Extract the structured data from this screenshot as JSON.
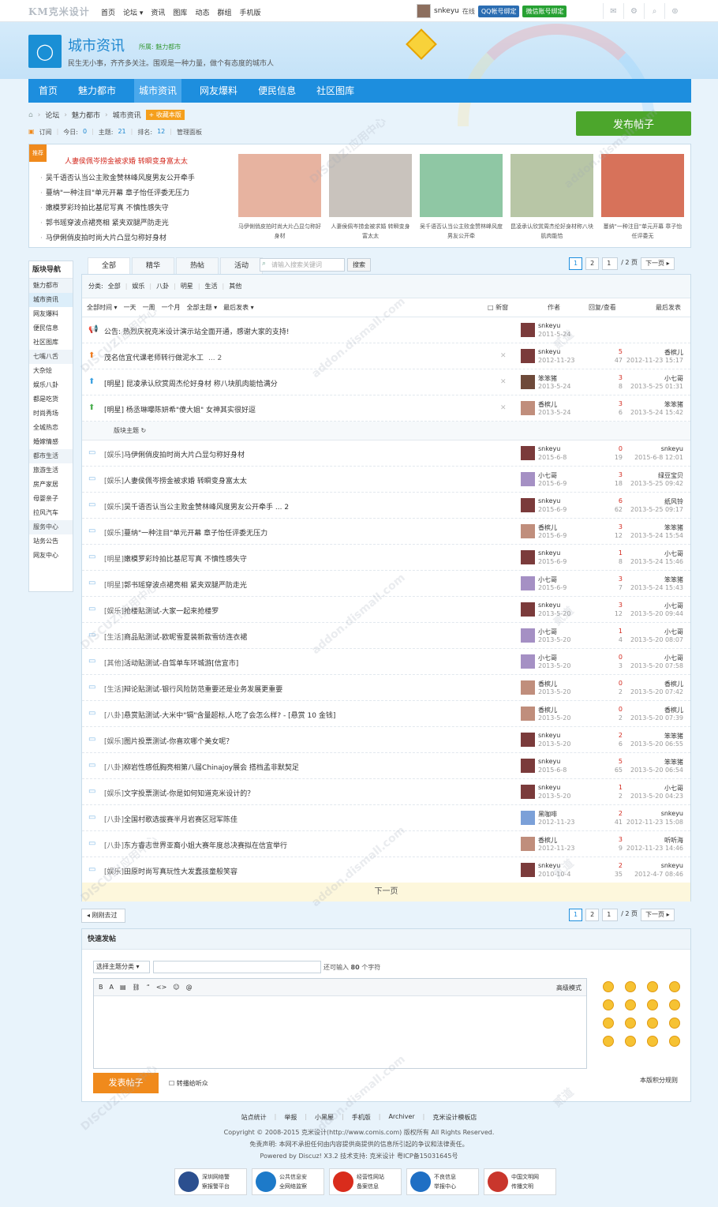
{
  "topbar": {
    "logo": "KM克米设计",
    "nav": [
      "首页",
      "论坛 ▾",
      "资讯",
      "图库",
      "动态",
      "群组",
      "手机版"
    ],
    "username": "snkeyu",
    "status": "在线",
    "qq_bind": "QQ帐号绑定",
    "wx_bind": "微信账号绑定",
    "icons": [
      "mail-icon",
      "gear-icon",
      "search-icon",
      "rss-icon"
    ]
  },
  "forum": {
    "title": "城市资讯",
    "owner": "所属: 魅力都市",
    "description": "民生无小事，齐齐多关注。围观是一种力量，做个有态度的城市人"
  },
  "mainnav": [
    "首页",
    "魅力都市",
    "城市资讯",
    "网友爆料",
    "便民信息",
    "社区图库"
  ],
  "mainnav_active": 2,
  "breadcrumb": [
    "论坛",
    "魅力都市",
    "城市资讯"
  ],
  "fav_label": "+ 收藏本版",
  "stats": {
    "subscribe": "订阅",
    "today_label": "今日:",
    "today": "0",
    "topics_label": "主题:",
    "topics": "21",
    "rank_label": "排名:",
    "rank": "12",
    "manage": "管理面板"
  },
  "new_thread_label": "发布帖子",
  "slide": {
    "tag": "推荐",
    "headline": "人妻侯佩岑捞金被求婚 转瞬变身富太太",
    "list": [
      "吴千语否认当公主败金赞林峰风度男友公开牵手",
      "蔓纳\"一种注目\"单元开幕 章子怡任评委无压力",
      "嫩模罗彩玲拍比基尼写真 不慎性感失守",
      "郭书瑶穿波点裙亮相 紧夹双腿严防走光",
      "马伊俐俏皮拍时尚大片凸显匀称好身材"
    ],
    "images": [
      {
        "caption": "马伊俐俏皮拍时尚大片凸显匀称好身材",
        "color": "#e7b3a0"
      },
      {
        "caption": "人妻侯佩岑捞金被求婚 转瞬变身富太太",
        "color": "#c9c3bd"
      },
      {
        "caption": "吴千语否认当公主败金赞林峰风度男友公开牵",
        "color": "#8fc7a4"
      },
      {
        "caption": "昆凌承认欣赏周杰伦好身材称八块肌肉能恰",
        "color": "#b8c6a6"
      },
      {
        "caption": "蔓纳\"一种注目\"单元开幕 章子怡任评委无",
        "color": "#d7725a"
      }
    ]
  },
  "sidebar": {
    "header": "版块导航",
    "items": [
      {
        "label": "魅力都市",
        "type": "grp"
      },
      {
        "label": "城市资讯",
        "type": "it",
        "active": true
      },
      {
        "label": "网友爆料",
        "type": "it"
      },
      {
        "label": "便民信息",
        "type": "it"
      },
      {
        "label": "社区图库",
        "type": "it"
      },
      {
        "label": "七嘴八舌",
        "type": "grp"
      },
      {
        "label": "大杂烩",
        "type": "it"
      },
      {
        "label": "娱乐八卦",
        "type": "it"
      },
      {
        "label": "都是吃货",
        "type": "it"
      },
      {
        "label": "时尚秀场",
        "type": "it"
      },
      {
        "label": "全城热恋",
        "type": "it"
      },
      {
        "label": "婚嫁情感",
        "type": "it"
      },
      {
        "label": "都市生活",
        "type": "grp"
      },
      {
        "label": "旅游生活",
        "type": "it"
      },
      {
        "label": "房产家居",
        "type": "it"
      },
      {
        "label": "母婴亲子",
        "type": "it"
      },
      {
        "label": "拉风汽车",
        "type": "it"
      },
      {
        "label": "服务中心",
        "type": "grp"
      },
      {
        "label": "站务公告",
        "type": "it"
      },
      {
        "label": "网友中心",
        "type": "it"
      }
    ]
  },
  "tabs": [
    "全部",
    "精华",
    "热帖",
    "活动"
  ],
  "search": {
    "placeholder": "请输入搜索关键词",
    "button": "搜索"
  },
  "pager": {
    "p1": "1",
    "p2": "2",
    "input": "1",
    "total": "/ 2 页",
    "next": "下一页 ▸"
  },
  "typebar": [
    "分类:",
    "全部",
    "|",
    "娱乐",
    "|",
    "八卦",
    "|",
    "明星",
    "|",
    "生活",
    "|",
    "其他"
  ],
  "filters": [
    "全部时间 ▾",
    "一天",
    "一周",
    "一个月",
    "全部主题 ▾",
    "最后发表 ▾"
  ],
  "col_headers": {
    "new": "□ 新窗",
    "author": "作者",
    "reply": "回复/查看",
    "last": "最后发表"
  },
  "announcement": {
    "icon": "📢",
    "text": "公告: 热烈庆祝克米设计演示站全面开通，感谢大家的支持!",
    "author": "snkeyu",
    "date": "2011-5-24"
  },
  "sticky": [
    {
      "icon": "⬆",
      "color": "#f07a1c",
      "title": "茂名信宜代课老师转行做泥水工",
      "extra": "... 2",
      "author": "snkeyu",
      "date": "2012-11-23",
      "reply": "5",
      "view": "47",
      "last_user": "香槟儿",
      "last_date": "2012-11-23 15:17"
    },
    {
      "icon": "⬆",
      "color": "#3aa0e0",
      "title": "[明星] 昆凌承认欣赏周杰伦好身材 称八块肌肉能恰满分",
      "extra": "",
      "author": "笨笨猪",
      "date": "2013-5-24",
      "reply": "3",
      "view": "8",
      "last_user": "小七哥",
      "last_date": "2013-5-25 01:31"
    },
    {
      "icon": "⬆",
      "color": "#4caf50",
      "title": "[明星] 杨丞琳曝陈妍希\"傻大姐\" 女神其实很好逗",
      "extra": "",
      "author": "香槟儿",
      "date": "2013-5-24",
      "reply": "3",
      "view": "6",
      "last_user": "笨笨猪",
      "last_date": "2013-5-24 15:42"
    }
  ],
  "sep_label": "版块主题 ↻",
  "threads": [
    {
      "cat": "[娱乐]",
      "title": "马伊俐俏皮拍时尚大片凸显匀称好身材",
      "author": "snkeyu",
      "date": "2015-6-8",
      "reply": "0",
      "view": "19",
      "last_user": "snkeyu",
      "last_date": "2015-6-8 12:01"
    },
    {
      "cat": "[娱乐]",
      "title": "人妻侯佩岑捞金被求婚 转瞬变身富太太",
      "author": "小七哥",
      "date": "2015-6-9",
      "reply": "3",
      "view": "18",
      "last_user": "绿豆宝贝",
      "last_date": "2013-5-25 09:42"
    },
    {
      "cat": "[娱乐]",
      "title": "吴千语否认当公主败金赞林峰风度男友公开牵手 ... 2",
      "author": "snkeyu",
      "date": "2015-6-9",
      "reply": "6",
      "view": "62",
      "last_user": "纸风铃",
      "last_date": "2013-5-25 09:17"
    },
    {
      "cat": "[娱乐]",
      "title": "蔓纳\"一种注目\"单元开幕 章子怡任评委无压力",
      "author": "香槟儿",
      "date": "2015-6-9",
      "reply": "3",
      "view": "12",
      "last_user": "笨笨猪",
      "last_date": "2013-5-24 15:54"
    },
    {
      "cat": "[明星]",
      "title": "嫩模罗彩玲拍比基尼写真 不慎性感失守",
      "author": "snkeyu",
      "date": "2015-6-9",
      "reply": "1",
      "view": "8",
      "last_user": "小七哥",
      "last_date": "2013-5-24 15:46"
    },
    {
      "cat": "[明星]",
      "title": "郭书瑶穿波点裙亮相 紧夹双腿严防走光",
      "author": "小七哥",
      "date": "2015-6-9",
      "reply": "3",
      "view": "7",
      "last_user": "笨笨猪",
      "last_date": "2013-5-24 15:43"
    },
    {
      "cat": "[娱乐]",
      "title": "抢楼贴测试-大家一起来抢楼罗",
      "author": "snkeyu",
      "date": "2013-5-20",
      "reply": "3",
      "view": "12",
      "last_user": "小七哥",
      "last_date": "2013-5-20 09:44"
    },
    {
      "cat": "[生活]",
      "title": "商品贴测试-欧昵雪夏装新款雪纺连衣裙",
      "author": "小七哥",
      "date": "2013-5-20",
      "reply": "1",
      "view": "4",
      "last_user": "小七哥",
      "last_date": "2013-5-20 08:07"
    },
    {
      "cat": "[其他]",
      "title": "活动贴测试-自驾单车环城游[信宜市]",
      "author": "小七哥",
      "date": "2013-5-20",
      "reply": "0",
      "view": "3",
      "last_user": "小七哥",
      "last_date": "2013-5-20 07:58"
    },
    {
      "cat": "[生活]",
      "title": "辩论贴测试-银行风险防范重要还是业务发展更重要",
      "author": "香槟儿",
      "date": "2013-5-20",
      "reply": "0",
      "view": "2",
      "last_user": "香槟儿",
      "last_date": "2013-5-20 07:42"
    },
    {
      "cat": "[八卦]",
      "title": "悬赏贴测试-大米中\"镉\"含量超标,人吃了会怎么样? - [悬赏 10 金钱]",
      "author": "香槟儿",
      "date": "2013-5-20",
      "reply": "0",
      "view": "2",
      "last_user": "香槟儿",
      "last_date": "2013-5-20 07:39"
    },
    {
      "cat": "[娱乐]",
      "title": "图片投票测试-你喜欢哪个美女呢？",
      "author": "snkeyu",
      "date": "2013-5-20",
      "reply": "2",
      "view": "6",
      "last_user": "笨笨猪",
      "last_date": "2013-5-20 06:55"
    },
    {
      "cat": "[八卦]",
      "title": "柳岩性感低胸亮相第八届Chinajoy展会 搭档孟非默契足",
      "author": "snkeyu",
      "date": "2015-6-8",
      "reply": "5",
      "view": "65",
      "last_user": "笨笨猪",
      "last_date": "2013-5-20 06:54"
    },
    {
      "cat": "[娱乐]",
      "title": "文字投票测试-你是如何知道克米设计的？",
      "author": "snkeyu",
      "date": "2013-5-20",
      "reply": "1",
      "view": "2",
      "last_user": "小七哥",
      "last_date": "2013-5-20 04:23"
    },
    {
      "cat": "[八卦]",
      "title": "全国村歌选拔赛半月岩赛区冠军陈佳",
      "author": "黑咖啡",
      "date": "2012-11-23",
      "reply": "2",
      "view": "41",
      "last_user": "snkeyu",
      "last_date": "2012-11-23 15:08"
    },
    {
      "cat": "[八卦]",
      "title": "东方睿志世界亚裔小姐大赛年度总决赛拟在信宜举行",
      "author": "香槟儿",
      "date": "2012-11-23",
      "reply": "3",
      "view": "9",
      "last_user": "听听海",
      "last_date": "2012-11-23 14:46"
    },
    {
      "cat": "[娱乐]",
      "title": "田原时尚写真玩性大发蠢孩童般笑容",
      "author": "snkeyu",
      "date": "2010-10-4",
      "reply": "2",
      "view": "35",
      "last_user": "snkeyu",
      "last_date": "2012-4-7 08:46"
    }
  ],
  "next_page": "下一页",
  "back_label": "◂ 刚刚去过",
  "quick": {
    "header": "快速发帖",
    "select": "选择主题分类 ▾",
    "hint_pre": "还可输入",
    "hint_num": "80",
    "hint_post": "个字符",
    "toolbar": [
      "B",
      "A",
      "▤",
      "⛓",
      "“",
      "<>",
      "☺",
      "@"
    ],
    "advanced": "高级模式",
    "submit": "发表帖子",
    "check": "转播给听众",
    "rule": "本版积分规则"
  },
  "footer": {
    "links": [
      "站点统计",
      "|",
      "举报",
      "|",
      "小黑屋",
      "|",
      "手机版",
      "|",
      "Archiver",
      "|",
      "克米设计模板店"
    ],
    "copyright": "Copyright © 2008-2015 克米设计(http://www.comis.com) 版权所有 All Rights Reserved.",
    "disclaimer": "免责声明: 本网不承担任何由内容提供商提供的信息所引起的争议和法律责任。",
    "powered": "Powered by Discuz! X3.2  技术支持: 克米设计 粤ICP备15031645号"
  },
  "badges": [
    {
      "l1": "深圳网络警",
      "l2": "察报警平台",
      "color": "#2b4f8f"
    },
    {
      "l1": "公共信息安",
      "l2": "全网络监察",
      "color": "#1d7ac9"
    },
    {
      "l1": "经营性网站",
      "l2": "备案信息",
      "color": "#d92c1c"
    },
    {
      "l1": "不良信息",
      "l2": "举报中心",
      "color": "#1f6fc4"
    },
    {
      "l1": "中国文明网",
      "l2": "传播文明",
      "color": "#c9362c"
    }
  ],
  "watermarks": [
    "DISCUZ!应用中心",
    "addon.dismall.com",
    "贰道"
  ]
}
